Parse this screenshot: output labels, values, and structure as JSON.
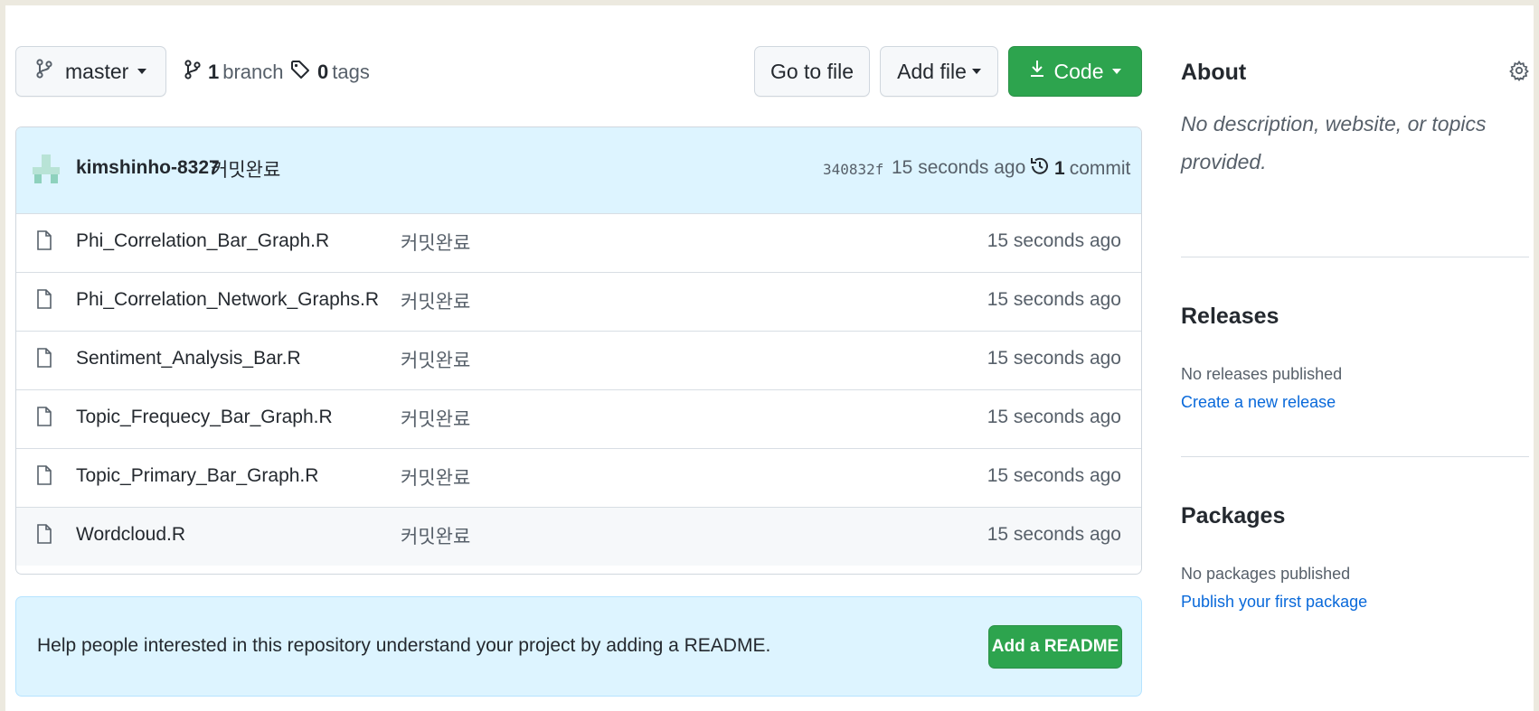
{
  "toolbar": {
    "branch_name": "master",
    "branch_count": "1",
    "branch_label": "branch",
    "tag_count": "0",
    "tag_label": "tags",
    "go_to_file": "Go to file",
    "add_file": "Add file",
    "code": "Code"
  },
  "commit": {
    "author": "kimshinho-8327",
    "message": "커밋완료",
    "sha": "340832f",
    "time": "15 seconds ago",
    "count": "1",
    "count_label": "commit"
  },
  "files": [
    {
      "name": "Phi_Correlation_Bar_Graph.R",
      "message": "커밋완료",
      "time": "15 seconds ago"
    },
    {
      "name": "Phi_Correlation_Network_Graphs.R",
      "message": "커밋완료",
      "time": "15 seconds ago"
    },
    {
      "name": "Sentiment_Analysis_Bar.R",
      "message": "커밋완료",
      "time": "15 seconds ago"
    },
    {
      "name": "Topic_Frequecy_Bar_Graph.R",
      "message": "커밋완료",
      "time": "15 seconds ago"
    },
    {
      "name": "Topic_Primary_Bar_Graph.R",
      "message": "커밋완료",
      "time": "15 seconds ago"
    },
    {
      "name": "Wordcloud.R",
      "message": "커밋완료",
      "time": "15 seconds ago"
    }
  ],
  "readme": {
    "text": "Help people interested in this repository understand your project by adding a README.",
    "button": "Add a README"
  },
  "about": {
    "title": "About",
    "description_line1": "No description, website, or topics",
    "description_line2": "provided."
  },
  "releases": {
    "title": "Releases",
    "empty": "No releases published",
    "link": "Create a new release"
  },
  "packages": {
    "title": "Packages",
    "empty": "No packages published",
    "link": "Publish your first package"
  },
  "colors": {
    "accent_green": "#2da44e",
    "link_blue": "#0969da",
    "header_blue": "#ddf4ff"
  }
}
